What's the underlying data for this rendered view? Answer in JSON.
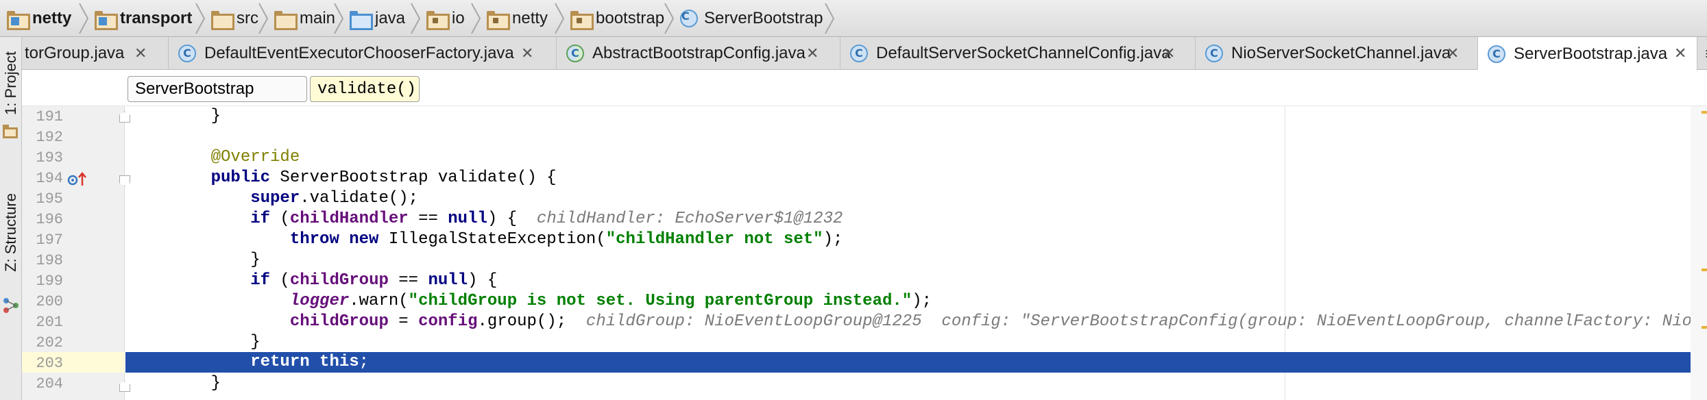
{
  "breadcrumbs": [
    {
      "label": "netty",
      "icon": "module-folder-icon"
    },
    {
      "label": "transport",
      "icon": "module-folder-icon"
    },
    {
      "label": "src",
      "icon": "folder-icon"
    },
    {
      "label": "main",
      "icon": "folder-icon"
    },
    {
      "label": "java",
      "icon": "source-folder-icon"
    },
    {
      "label": "io",
      "icon": "package-icon"
    },
    {
      "label": "netty",
      "icon": "package-icon"
    },
    {
      "label": "bootstrap",
      "icon": "package-icon"
    },
    {
      "label": "ServerBootstrap",
      "icon": "class-icon"
    }
  ],
  "tool_windows": {
    "project": "1: Project",
    "structure": "Z: Structure"
  },
  "tabs": [
    {
      "label": "torGroup.java",
      "close": "✕"
    },
    {
      "label": "DefaultEventExecutorChooserFactory.java",
      "close": "✕"
    },
    {
      "label": "AbstractBootstrapConfig.java",
      "close": "✕"
    },
    {
      "label": "DefaultServerSocketChannelConfig.java",
      "close": "✕"
    },
    {
      "label": "NioServerSocketChannel.java",
      "close": "✕"
    },
    {
      "label": "ServerBootstrap.java",
      "close": "✕",
      "active": true
    }
  ],
  "tab_overflow": "≡",
  "class_icon_letter": "C",
  "editor_breadcrumbs": {
    "class": "ServerBootstrap",
    "method": "validate()"
  },
  "line_numbers": [
    "191",
    "192",
    "193",
    "194",
    "195",
    "196",
    "197",
    "198",
    "199",
    "200",
    "201",
    "202",
    "203",
    "204"
  ],
  "code": {
    "l191": "    }",
    "l193": "@Override",
    "l194_kw": "public",
    "l194_rest": " ServerBootstrap validate() {",
    "l195_kw": "super",
    "l195_rest": ".validate();",
    "l196_if": "if",
    "l196_open": " (",
    "l196_field": "childHandler",
    "l196_op": " == ",
    "l196_null": "null",
    "l196_close": ") {",
    "l196_hint": "  childHandler: EchoServer$1@1232",
    "l197_throw": "throw",
    "l197_new": "new",
    "l197_cls": " IllegalStateException(",
    "l197_str": "\"childHandler not set\"",
    "l197_end": ");",
    "l198": "}",
    "l199_if": "if",
    "l199_open": " (",
    "l199_field": "childGroup",
    "l199_op": " == ",
    "l199_null": "null",
    "l199_close": ") {",
    "l200_logger": "logger",
    "l200_call": ".warn(",
    "l200_str": "\"childGroup is not set. Using parentGroup instead.\"",
    "l200_end": ");",
    "l201_field": "childGroup",
    "l201_eq": " = ",
    "l201_cfg": "config",
    "l201_call": ".group();",
    "l201_hint": "  childGroup: NioEventLoopGroup@1225  config: \"ServerBootstrapConfig(group: NioEventLoopGroup, channelFactory: NioServerSock",
    "l202": "}",
    "l203_kw": "return",
    "l203_this": "this",
    "l203_end": ";",
    "l204": "}"
  },
  "colors": {
    "keyword": "#000080",
    "annotation": "#808000",
    "field": "#660e7a",
    "string": "#008000",
    "execution_line": "#214faa"
  }
}
